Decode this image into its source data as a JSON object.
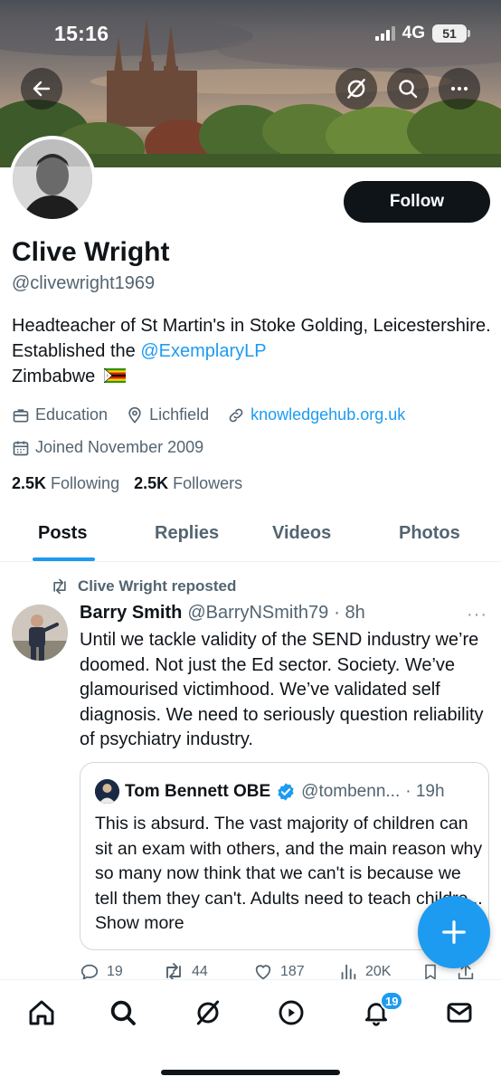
{
  "status_bar": {
    "time": "15:16",
    "network": "4G",
    "battery": "51"
  },
  "profile": {
    "name": "Clive Wright",
    "handle": "@clivewright1969",
    "follow_label": "Follow",
    "bio_part1": "Headteacher of St Martin's in Stoke Golding, Leicestershire. Established the ",
    "bio_mention": "@ExemplaryLP",
    "bio_part2": "Zimbabwe",
    "category": "Education",
    "location": "Lichfield",
    "website": "knowledgehub.org.uk",
    "joined": "Joined November 2009",
    "following_count": "2.5K",
    "following_label": "Following",
    "followers_count": "2.5K",
    "followers_label": "Followers"
  },
  "tabs": [
    {
      "label": "Posts",
      "active": true
    },
    {
      "label": "Replies",
      "active": false
    },
    {
      "label": "Videos",
      "active": false
    },
    {
      "label": "Photos",
      "active": false
    }
  ],
  "post": {
    "repost_label": "Clive Wright reposted",
    "author_name": "Barry Smith",
    "author_handle": "@BarryNSmith79",
    "time": "· 8h",
    "more": "···",
    "text": "Until we tackle validity of the SEND industry we’re doomed. Not just the Ed sector. Society. We’ve glamourised victimhood. We’ve validated self diagnosis. We need to seriously question reliability of psychiatry industry.",
    "quote": {
      "author_name": "Tom Bennett OBE",
      "author_handle": "@tombenn...",
      "time": "· 19h",
      "text": "This is absurd. The vast majority of children can sit an exam with others, and the main reason why so many now think that we can't is because we tell them they can't. Adults need to teach childre... Show more"
    },
    "stats": {
      "replies": "19",
      "reposts": "44",
      "likes": "187",
      "views": "20K"
    }
  },
  "nav": {
    "notifications_badge": "19"
  },
  "colors": {
    "accent": "#1d9bf0",
    "text": "#0f1419",
    "secondary": "#536471",
    "follow_bg": "#0f1419"
  },
  "icons": [
    "back-arrow-icon",
    "grok-icon",
    "search-icon",
    "more-icon",
    "briefcase-icon",
    "location-pin-icon",
    "link-icon",
    "calendar-icon",
    "repost-icon",
    "verified-badge-icon",
    "reply-icon",
    "like-icon",
    "views-icon",
    "bookmark-icon",
    "share-icon",
    "compose-plus-icon",
    "home-icon",
    "spaces-icon",
    "notifications-bell-icon",
    "messages-icon"
  ]
}
